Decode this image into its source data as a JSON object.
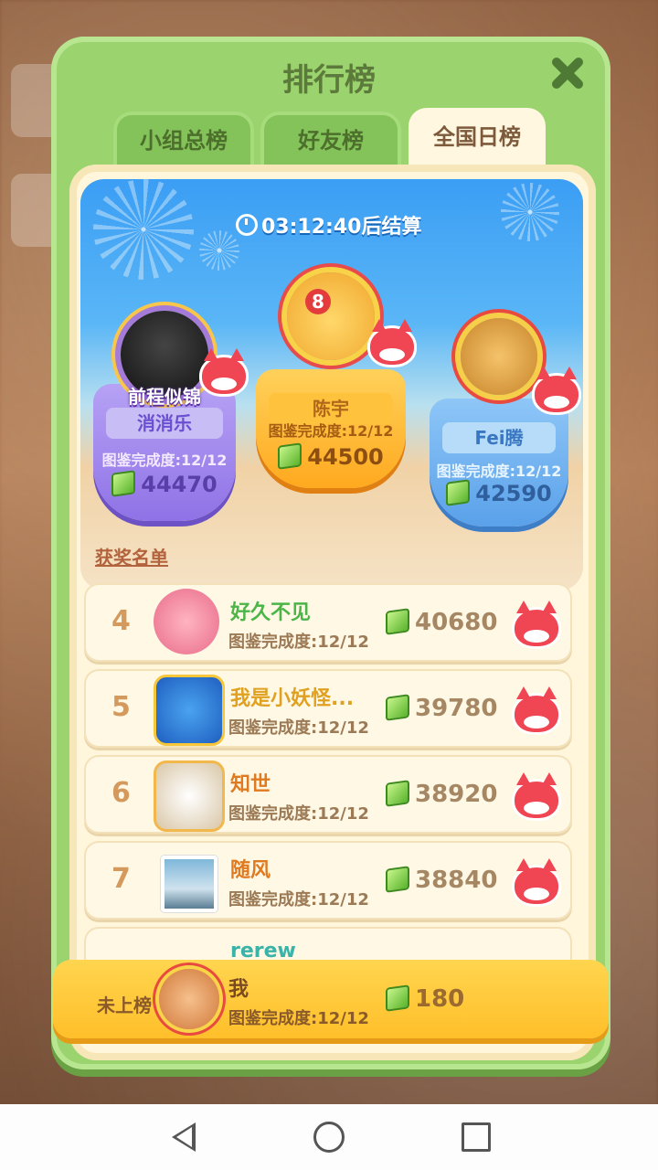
{
  "header": {
    "title": "排行榜"
  },
  "tabs": [
    {
      "label": "小组总榜",
      "active": false
    },
    {
      "label": "好友榜",
      "active": false
    },
    {
      "label": "全国日榜",
      "active": true
    }
  ],
  "timer": {
    "text": "03:12:40后结算"
  },
  "podium": [
    {
      "place": 2,
      "badge": "前程似锦",
      "name": "消消乐",
      "progress": "图鉴完成度:12/12",
      "score": "44470"
    },
    {
      "place": 1,
      "crown_number": "8",
      "name": "陈宇",
      "progress": "图鉴完成度:12/12",
      "score": "44500"
    },
    {
      "place": 3,
      "name": "Fei腾",
      "progress": "图鉴完成度:12/12",
      "score": "42590"
    }
  ],
  "awards_label": "获奖名单",
  "rows": [
    {
      "rank": "4",
      "name": "好久不见",
      "progress": "图鉴完成度:12/12",
      "score": "40680"
    },
    {
      "rank": "5",
      "name": "我是小妖怪...",
      "progress": "图鉴完成度:12/12",
      "score": "39780"
    },
    {
      "rank": "6",
      "name": "知世",
      "progress": "图鉴完成度:12/12",
      "score": "38920"
    },
    {
      "rank": "7",
      "name": "随风",
      "progress": "图鉴完成度:12/12",
      "score": "38840"
    },
    {
      "rank": "",
      "name": "rerew",
      "progress": "",
      "score": ""
    }
  ],
  "me": {
    "label": "未上榜",
    "name": "我",
    "progress": "图鉴完成度:12/12",
    "score": "180"
  },
  "colors": {
    "panel": "#9bd36e",
    "accent_gold": "#ffbf2a",
    "fox_red": "#f04553"
  }
}
